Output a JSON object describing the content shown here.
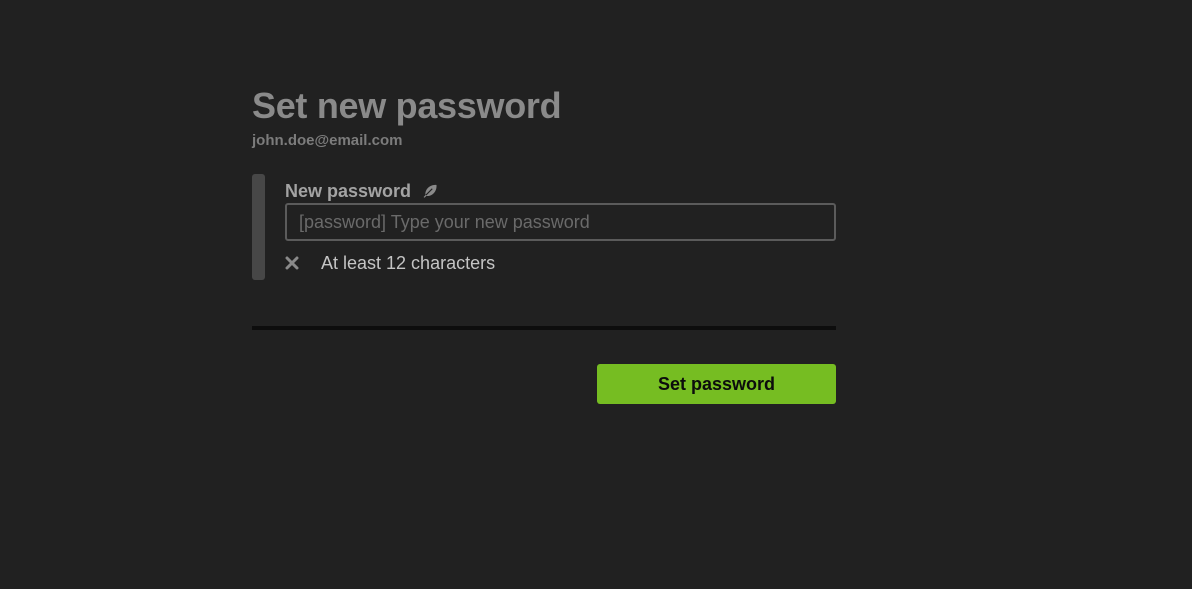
{
  "header": {
    "title": "Set new password",
    "email": "john.doe@email.com"
  },
  "form": {
    "field_label": "New password",
    "field_icon": "feather-icon",
    "input_value": "",
    "input_placeholder": "[password] Type your new password",
    "requirements": [
      {
        "text": "At least 12 characters",
        "icon": "close-icon",
        "met": false
      }
    ],
    "submit_label": "Set password"
  },
  "colors": {
    "background": "#212121",
    "accent": "#76bd22",
    "sidebar": "#474747",
    "divider": "#0d0d0d"
  }
}
